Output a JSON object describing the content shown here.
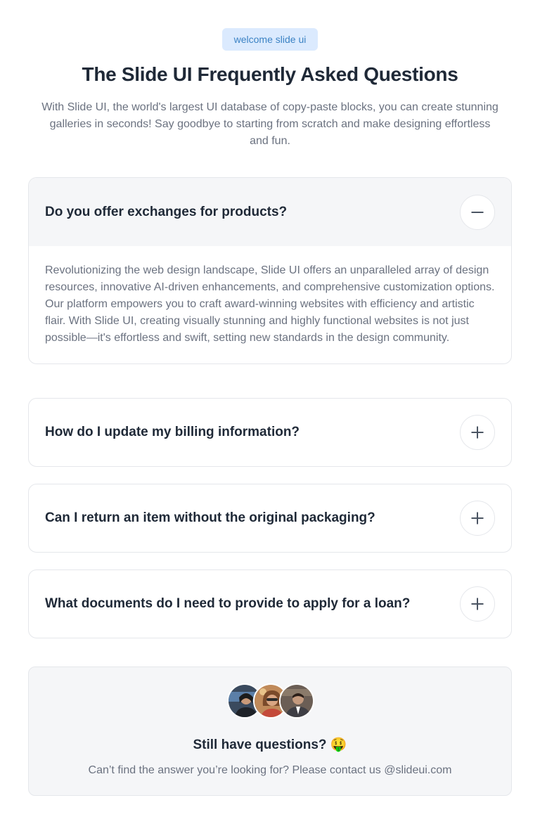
{
  "header": {
    "badge": "welcome slide ui",
    "title": "The Slide UI Frequently Asked Questions",
    "intro": "With Slide UI, the world's largest UI database of copy-paste blocks, you can create stunning galleries in seconds! Say goodbye to starting from scratch and make designing effortless and fun."
  },
  "faq": [
    {
      "question": "Do you offer exchanges for products?",
      "answer": "Revolutionizing the web design landscape, Slide UI offers an unparalleled array of design resources, innovative AI-driven enhancements, and comprehensive customization options. Our platform empowers you to craft award-winning websites with efficiency and artistic flair. With Slide UI, creating visually stunning and highly functional websites is not just possible—it's effortless and swift, setting new standards in the design community.",
      "expanded": true,
      "icon": "minus-icon"
    },
    {
      "question": "How do I update my billing information?",
      "expanded": false,
      "icon": "plus-icon"
    },
    {
      "question": "Can I return an item without the original packaging?",
      "expanded": false,
      "icon": "plus-icon"
    },
    {
      "question": "What documents do I need to provide to apply for a loan?",
      "expanded": false,
      "icon": "plus-icon"
    }
  ],
  "support": {
    "title": "Still have questions? 🤑",
    "text": "Can’t find the answer you’re looking for? Please contact us @slideui.com",
    "avatars": [
      "avatar-woman-office",
      "avatar-woman-sunglasses",
      "avatar-man-suit"
    ]
  },
  "colors": {
    "badge_bg": "#dbeafe",
    "badge_text": "#3b82c4",
    "heading": "#1f2937",
    "muted": "#6b7280",
    "panel_bg": "#f5f6f8",
    "border": "#e5e7eb"
  }
}
